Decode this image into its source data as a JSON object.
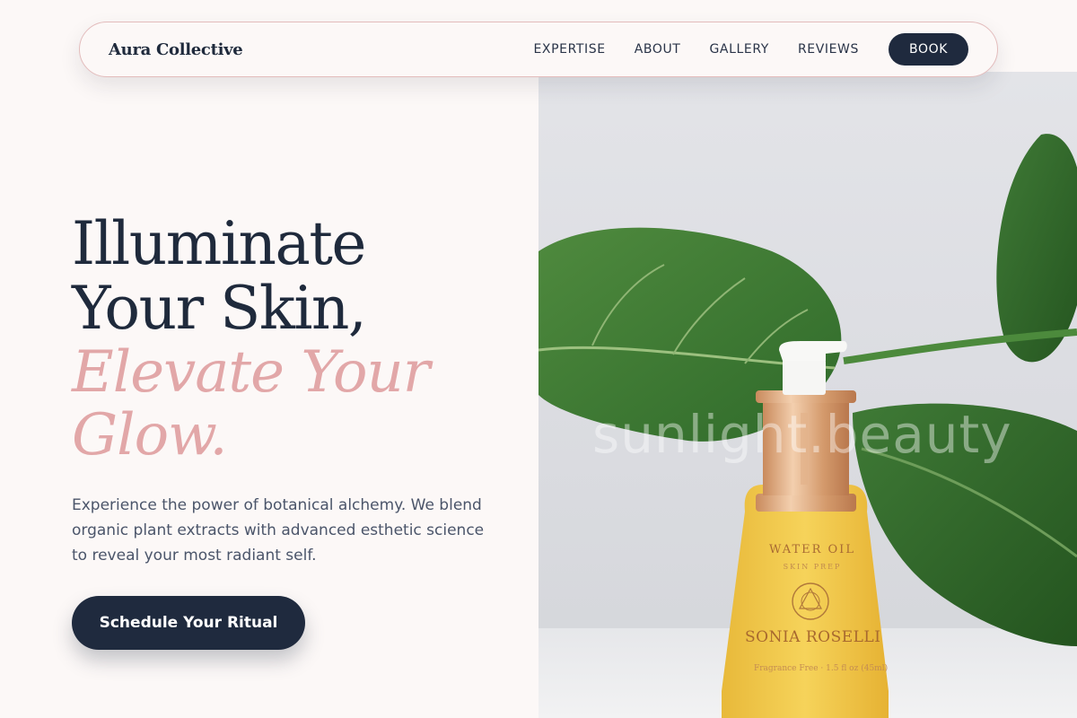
{
  "nav": {
    "brand": "Aura Collective",
    "links": [
      "EXPERTISE",
      "ABOUT",
      "GALLERY",
      "REVIEWS"
    ],
    "book_label": "BOOK"
  },
  "hero": {
    "headline_line1": "Illuminate",
    "headline_line2": "Your Skin,",
    "accent_line1": "Elevate Your",
    "accent_line2": "Glow.",
    "lead": "Experience the power of botanical alchemy. We blend organic plant extracts with advanced esthetic science to reveal your most radiant self.",
    "cta_label": "Schedule Your Ritual"
  },
  "image": {
    "watermark": "sunlight.beauty",
    "product_brand": "WATER OIL",
    "product_sub": "SKIN PREP",
    "product_name": "SONIA ROSELLI",
    "product_fine": "Fragrance Free · 1.5 fl oz (45ml)"
  },
  "colors": {
    "background": "#fcf8f7",
    "navy": "#1f2a3e",
    "accent_pink": "#e2a7a8",
    "nav_border": "#e3bcbc"
  }
}
